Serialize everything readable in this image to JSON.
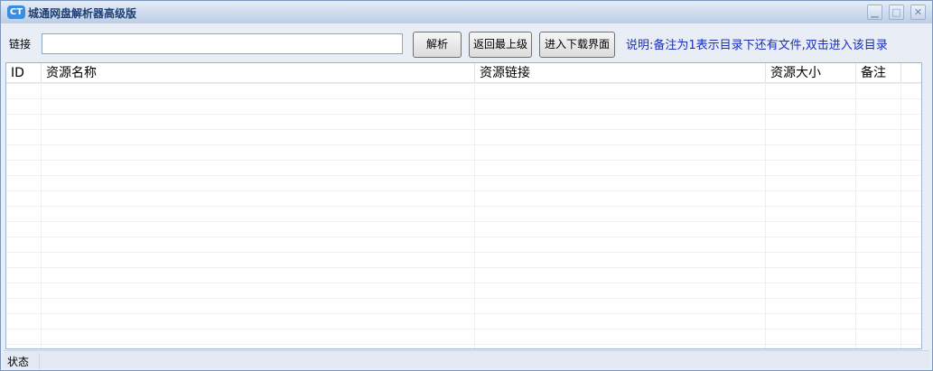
{
  "window": {
    "logo": "CT",
    "title": "城通网盘解析器高级版",
    "minimize": "▁",
    "maximize": "□",
    "close": "✕"
  },
  "toolbar": {
    "link_label": "链接",
    "link_value": "",
    "parse": "解析",
    "back_top": "返回最上级",
    "download": "进入下载界面",
    "note": "说明:备注为1表示目录下还有文件,双击进入该目录"
  },
  "table": {
    "columns": [
      "ID",
      "资源名称",
      "资源链接",
      "资源大小",
      "备注"
    ],
    "rows": []
  },
  "status": {
    "label": "状态"
  }
}
